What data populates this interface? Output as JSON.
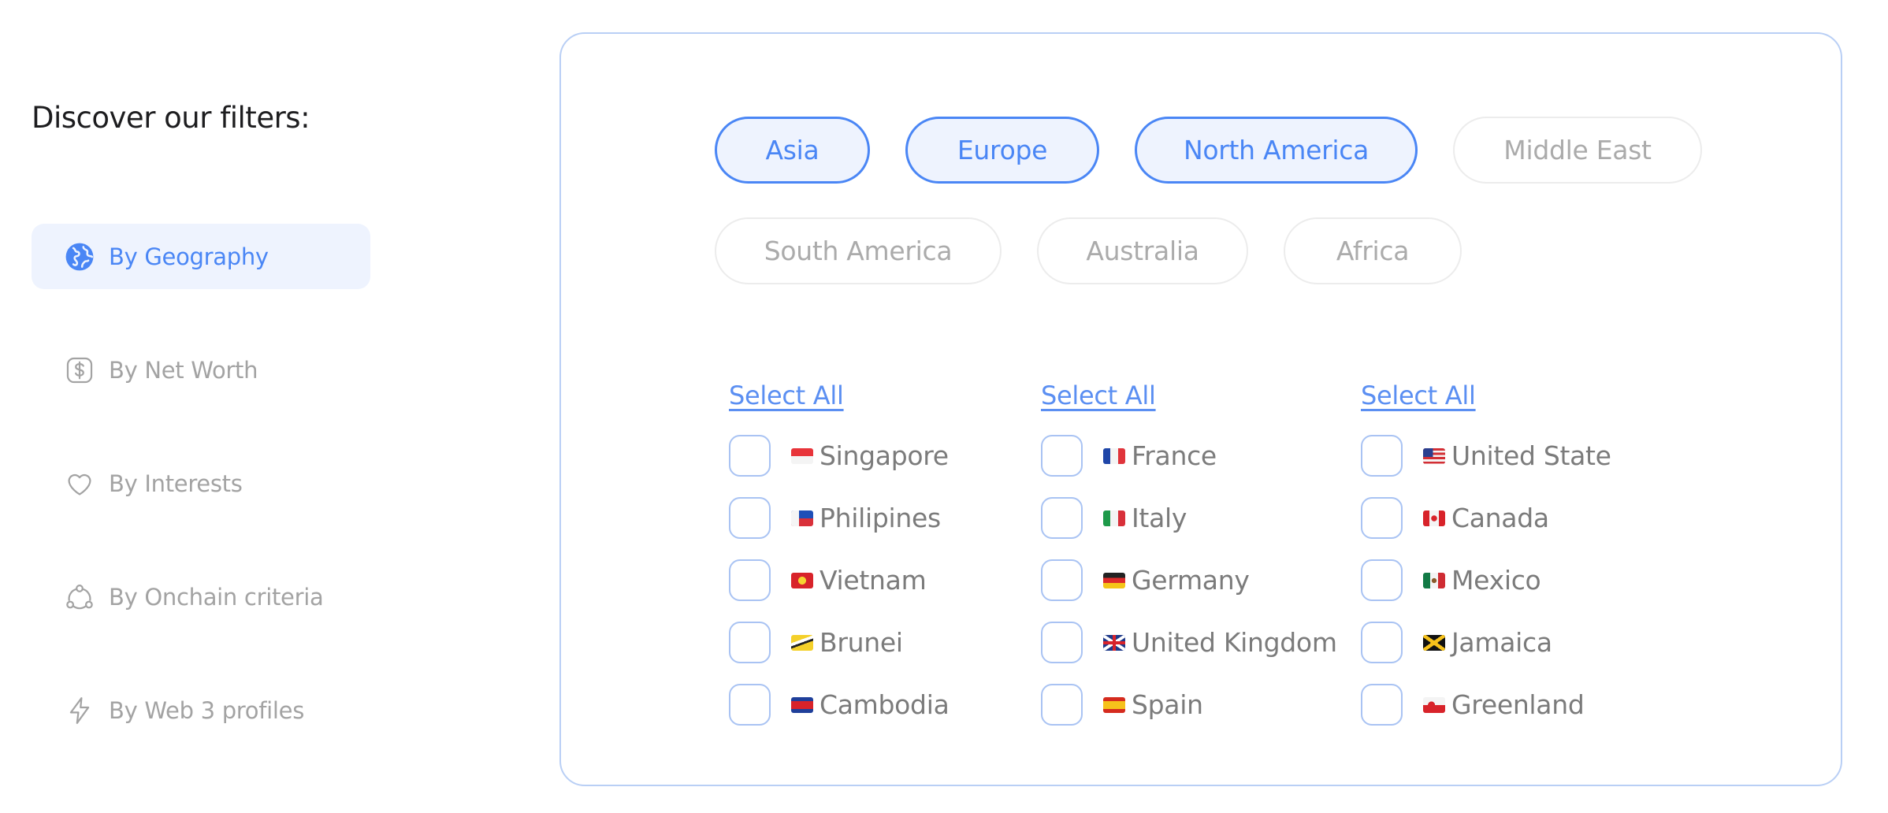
{
  "sidebar": {
    "title": "Discover our filters:",
    "items": [
      {
        "label": "By Geography",
        "icon": "globe-icon",
        "active": true
      },
      {
        "label": "By Net Worth",
        "icon": "dollar-square-icon",
        "active": false
      },
      {
        "label": "By Interests",
        "icon": "heart-icon",
        "active": false
      },
      {
        "label": "By Onchain criteria",
        "icon": "network-icon",
        "active": false
      },
      {
        "label": "By Web 3 profiles",
        "icon": "lightning-icon",
        "active": false
      }
    ]
  },
  "regions": [
    {
      "label": "Asia",
      "selected": true
    },
    {
      "label": "Europe",
      "selected": true
    },
    {
      "label": "North America",
      "selected": true
    },
    {
      "label": "Middle East",
      "selected": false
    },
    {
      "label": "South America",
      "selected": false
    },
    {
      "label": "Australia",
      "selected": false
    },
    {
      "label": "Africa",
      "selected": false
    }
  ],
  "columns": [
    {
      "select_all": "Select All",
      "countries": [
        "Singapore",
        "Philipines",
        "Vietnam",
        "Brunei",
        "Cambodia"
      ]
    },
    {
      "select_all": "Select All",
      "countries": [
        "France",
        "Italy",
        "Germany",
        "United Kingdom",
        "Spain"
      ]
    },
    {
      "select_all": "Select All",
      "countries": [
        "United State",
        "Canada",
        "Mexico",
        "Jamaica",
        "Greenland"
      ]
    }
  ],
  "colors": {
    "accent": "#4a86f5",
    "accent_bg": "#eef3fe",
    "muted_text": "#a3a3a3",
    "panel_border": "#b9cff5"
  }
}
